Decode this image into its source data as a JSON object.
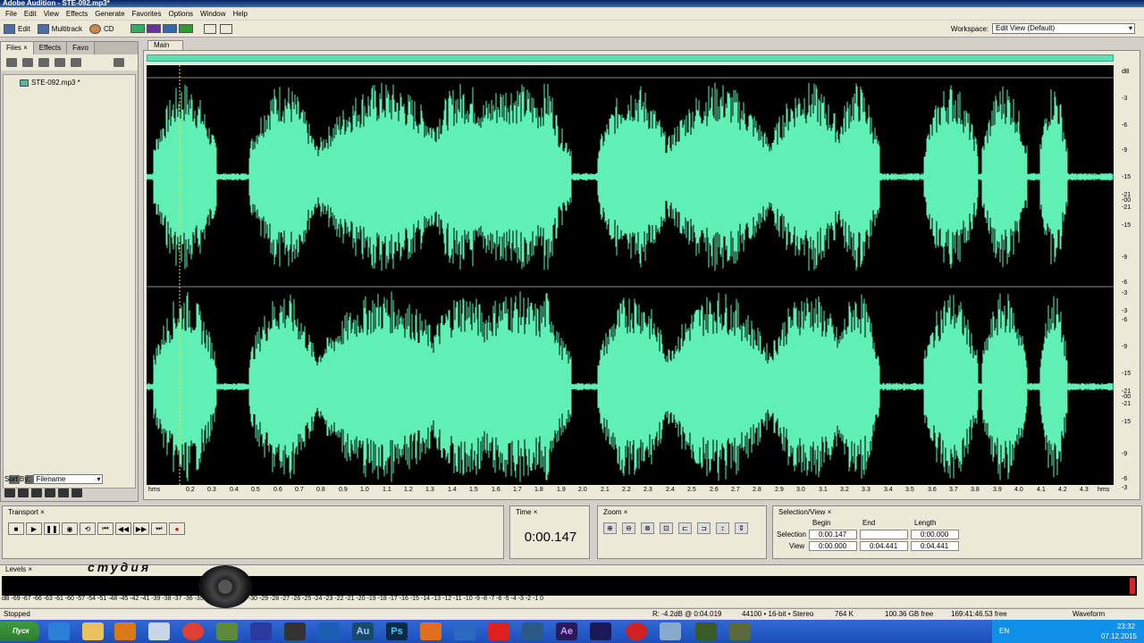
{
  "window": {
    "title": "Adobe Audition - STE-092.mp3*"
  },
  "menu": [
    "File",
    "Edit",
    "View",
    "Effects",
    "Generate",
    "Favorites",
    "Options",
    "Window",
    "Help"
  ],
  "toolbar": {
    "edit_label": "Edit",
    "multitrack_label": "Multitrack",
    "cd_label": "CD",
    "workspace_label": "Workspace:",
    "workspace_value": "Edit View (Default)"
  },
  "left_panel": {
    "tabs": [
      "Files",
      "Effects",
      "Favo"
    ],
    "file": "STE-092.mp3 *",
    "count_badge": "0",
    "sort_label": "Sort By:",
    "sort_value": "Filename"
  },
  "editor": {
    "tab": "Main",
    "db_ticks": [
      "dB",
      "-3",
      "-6",
      "-9",
      "-15",
      "-21",
      "-00",
      "-21",
      "-15",
      "-9",
      "-6",
      "-3"
    ],
    "time_ticks": [
      "hms",
      "0.2",
      "0.3",
      "0.4",
      "0.5",
      "0.6",
      "0.7",
      "0.8",
      "0.9",
      "1.0",
      "1.1",
      "1.2",
      "1.3",
      "1.4",
      "1.5",
      "1.6",
      "1.7",
      "1.8",
      "1.9",
      "2.0",
      "2.1",
      "2.2",
      "2.3",
      "2.4",
      "2.5",
      "2.6",
      "2.7",
      "2.8",
      "2.9",
      "3.0",
      "3.1",
      "3.2",
      "3.3",
      "3.4",
      "3.5",
      "3.6",
      "3.7",
      "3.8",
      "3.9",
      "4.0",
      "4.1",
      "4.2",
      "4.3",
      "hms"
    ]
  },
  "panels": {
    "transport_title": "Transport",
    "time_title": "Time",
    "time_value": "0:00.147",
    "zoom_title": "Zoom",
    "selection_title": "Selection/View",
    "col_begin": "Begin",
    "col_end": "End",
    "col_length": "Length",
    "row_selection": "Selection",
    "row_view": "View",
    "sel_begin": "0:00.147",
    "sel_end": "",
    "sel_length": "0:00.000",
    "view_begin": "0:00.000",
    "view_end": "0:04.441",
    "view_length": "0:04.441"
  },
  "levels": {
    "title": "Levels",
    "watermark": "студия",
    "scale": "dB -69 -67 -66 -63 -61 -60 -57 -54 -51 -48 -45 -42 -41 -39 -38 -37 -36 -35 -34 -33 -32 -31 -30 -29 -28 -27 -26 -25 -24 -23 -22 -21 -20 -19 -18 -17 -16 -15 -14 -13 -12 -11 -10 -9 -8 -7 -6 -5 -4 -3 -2 -1 0"
  },
  "status": {
    "state": "Stopped",
    "cursor": "R: -4.2dB @  0:04.019",
    "format": "44100 • 16-bit • Stereo",
    "size": "764 K",
    "free": "100.36 GB free",
    "free_time": "169:41:46.53 free",
    "view": "Waveform"
  },
  "taskbar": {
    "start": "Пуск",
    "lang": "EN",
    "time": "23:32",
    "date": "07.12.2015"
  },
  "colors": {
    "wave": "#5ff0b4",
    "wave_bg": "#000000"
  }
}
